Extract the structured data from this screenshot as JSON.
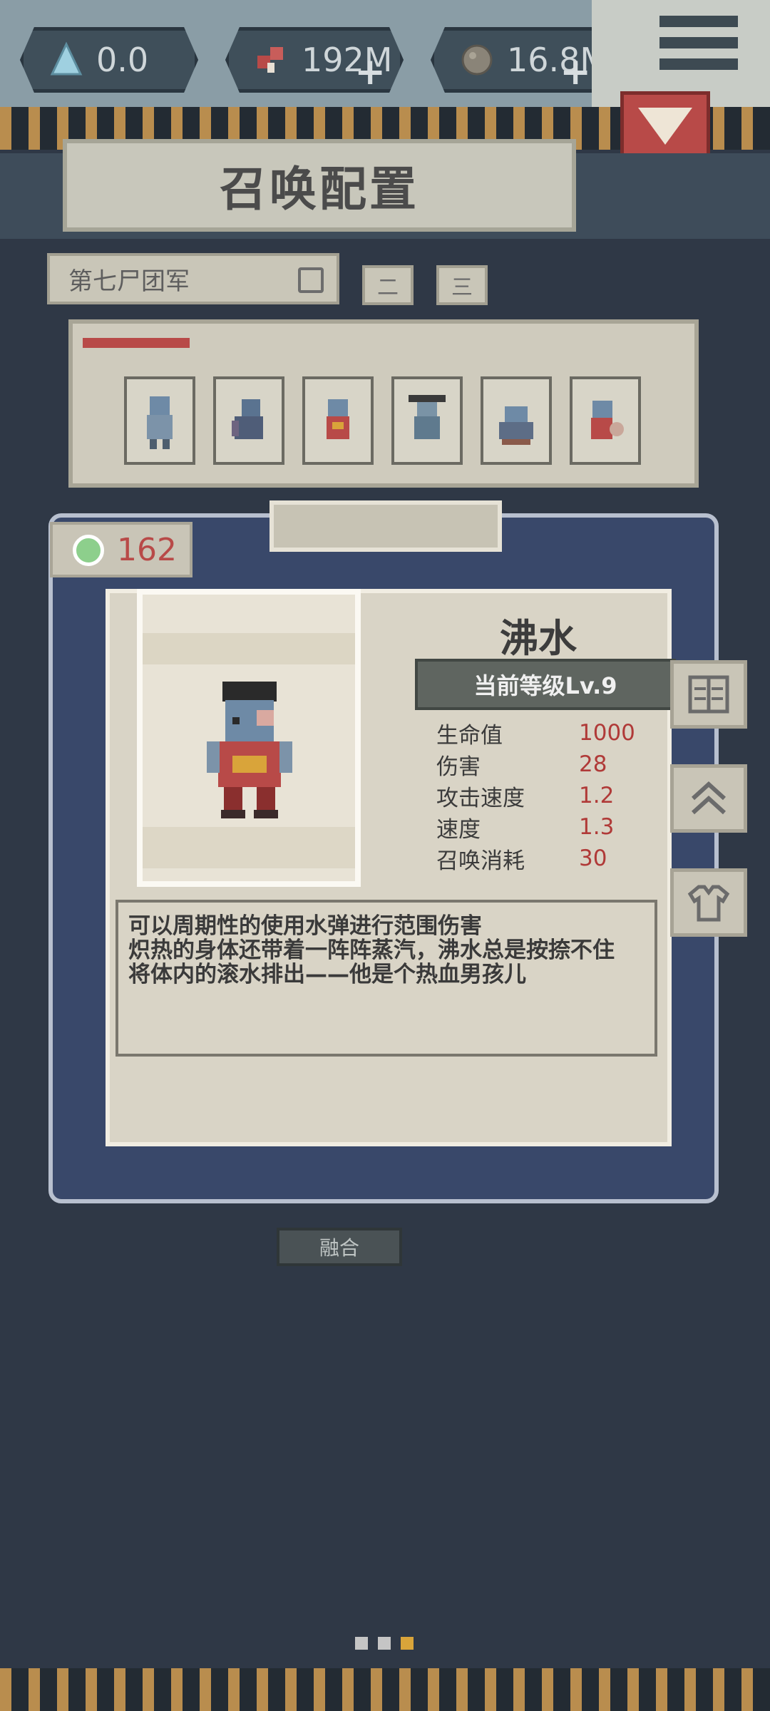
{
  "resources": {
    "crystal": "0.0",
    "meat": "192M",
    "rock": "16.8M",
    "plus": "+"
  },
  "header": {
    "title": "召唤配置"
  },
  "team": {
    "name": "第七尸团军",
    "tabs": [
      "二",
      "三"
    ]
  },
  "roster": {
    "slots": [
      "zombie-1",
      "zombie-2",
      "zombie-3",
      "zombie-4",
      "zombie-5",
      "zombie-6"
    ]
  },
  "currency": {
    "gems": "162",
    "gem_color": "#8dcf8c"
  },
  "unit": {
    "name": "沸水",
    "level_label": "当前等级Lv.9",
    "stats": [
      {
        "label": "生命值",
        "value": "1000"
      },
      {
        "label": "伤害",
        "value": "28"
      },
      {
        "label": "攻击速度",
        "value": "1.2"
      },
      {
        "label": "速度",
        "value": "1.3"
      },
      {
        "label": "召唤消耗",
        "value": "30"
      }
    ],
    "description": [
      "可以周期性的使用水弹进行范围伤害",
      "炽热的身体还带着一阵阵蒸汽，沸水总是按捺不住",
      "将体内的滚水排出——他是个热血男孩儿"
    ]
  },
  "actions": {
    "fuse_label": "融合"
  },
  "pager": {
    "count": 3,
    "active": 2
  },
  "colors": {
    "accent_red": "#b84a48",
    "stat_value": "#b03a38",
    "panel_blue": "#39486a"
  }
}
